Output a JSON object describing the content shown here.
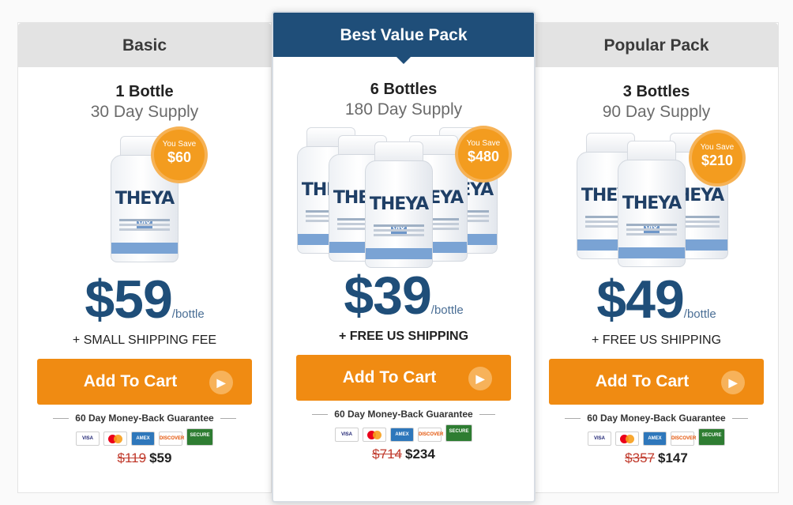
{
  "colors": {
    "navy": "#1f4e79",
    "orange": "#f08b12",
    "badge": "#f39c1f",
    "header_gray": "#e3e3e3"
  },
  "cards": [
    {
      "header": "Basic",
      "quantity": "1 Bottle",
      "supply": "30 Day Supply",
      "bottle_brand": "THEYA",
      "bottle_tag": "VIX",
      "badge_top": "You Save",
      "badge_amount": "$60",
      "price": "$59",
      "per": "/bottle",
      "shipping": "+ SMALL SHIPPING FEE",
      "cta": "Add To Cart",
      "guarantee": "60 Day Money-Back Guarantee",
      "payment_icons": [
        "VISA",
        "mastercard",
        "AMEX",
        "DISCOVER",
        "SECURE"
      ],
      "old_total": "$119",
      "new_total": "$59"
    },
    {
      "header": "Best Value Pack",
      "quantity": "6 Bottles",
      "supply": "180 Day Supply",
      "bottle_brand": "THEYA",
      "bottle_tag": "VIX",
      "badge_top": "You Save",
      "badge_amount": "$480",
      "price": "$39",
      "per": "/bottle",
      "shipping": "+ FREE US SHIPPING",
      "cta": "Add To Cart",
      "guarantee": "60 Day Money-Back Guarantee",
      "payment_icons": [
        "VISA",
        "mastercard",
        "AMEX",
        "DISCOVER",
        "SECURE"
      ],
      "old_total": "$714",
      "new_total": "$234"
    },
    {
      "header": "Popular Pack",
      "quantity": "3 Bottles",
      "supply": "90 Day Supply",
      "bottle_brand": "THEYA",
      "bottle_tag": "VIX",
      "badge_top": "You Save",
      "badge_amount": "$210",
      "price": "$49",
      "per": "/bottle",
      "shipping": "+ FREE US SHIPPING",
      "cta": "Add To Cart",
      "guarantee": "60 Day Money-Back Guarantee",
      "payment_icons": [
        "VISA",
        "mastercard",
        "AMEX",
        "DISCOVER",
        "SECURE"
      ],
      "old_total": "$357",
      "new_total": "$147"
    }
  ]
}
